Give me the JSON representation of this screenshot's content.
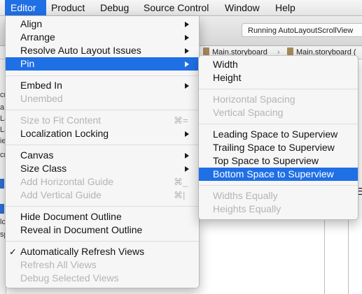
{
  "menubar": {
    "items": [
      {
        "label": "Editor",
        "active": true
      },
      {
        "label": "Product"
      },
      {
        "label": "Debug"
      },
      {
        "label": "Source Control"
      },
      {
        "label": "Window"
      },
      {
        "label": "Help"
      }
    ]
  },
  "toolbar": {
    "status": "Running AutoLayoutScrollView"
  },
  "jumpbar": {
    "items": [
      "Main.storyboard",
      "Main.storyboard ("
    ]
  },
  "navigator": {
    "fragments": [
      "cr",
      "a",
      "La",
      "La",
      "ie",
      "cr",
      "lc",
      "sp"
    ]
  },
  "canvas": {
    "fragment": "E"
  },
  "editor_menu": {
    "items": [
      {
        "label": "Align",
        "submenu": true
      },
      {
        "label": "Arrange",
        "submenu": true
      },
      {
        "label": "Resolve Auto Layout Issues",
        "submenu": true
      },
      {
        "label": "Pin",
        "submenu": true,
        "highlighted": true
      },
      {
        "label": "Embed In",
        "submenu": true
      },
      {
        "label": "Unembed",
        "disabled": true
      },
      {
        "label": "Size to Fit Content",
        "disabled": true,
        "shortcut": "⌘="
      },
      {
        "label": "Localization Locking",
        "submenu": true
      },
      {
        "label": "Canvas",
        "submenu": true
      },
      {
        "label": "Size Class",
        "submenu": true
      },
      {
        "label": "Add Horizontal Guide",
        "disabled": true,
        "shortcut": "⌘_"
      },
      {
        "label": "Add Vertical Guide",
        "disabled": true,
        "shortcut": "⌘|"
      },
      {
        "label": "Hide Document Outline"
      },
      {
        "label": "Reveal in Document Outline"
      },
      {
        "label": "Automatically Refresh Views",
        "checked": true,
        "check": "✓"
      },
      {
        "label": "Refresh All Views",
        "disabled": true
      },
      {
        "label": "Debug Selected Views",
        "disabled": true
      }
    ]
  },
  "pin_menu": {
    "items": [
      {
        "label": "Width"
      },
      {
        "label": "Height"
      },
      {
        "label": "Horizontal Spacing",
        "disabled": true
      },
      {
        "label": "Vertical Spacing",
        "disabled": true
      },
      {
        "label": "Leading Space to Superview"
      },
      {
        "label": "Trailing Space to Superview"
      },
      {
        "label": "Top Space to Superview"
      },
      {
        "label": "Bottom Space to Superview",
        "highlighted": true
      },
      {
        "label": "Widths Equally",
        "disabled": true
      },
      {
        "label": "Heights Equally",
        "disabled": true
      }
    ]
  },
  "colors": {
    "highlight": "#1f6fe5",
    "disabled_text": "#b4b4b4",
    "menu_background": "#f6f6f6"
  }
}
